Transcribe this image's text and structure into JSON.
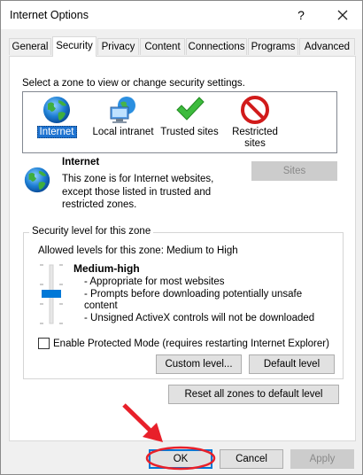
{
  "window": {
    "title": "Internet Options"
  },
  "titlebar": {
    "help_label": "?"
  },
  "tabs": [
    {
      "label": "General"
    },
    {
      "label": "Security"
    },
    {
      "label": "Privacy"
    },
    {
      "label": "Content"
    },
    {
      "label": "Connections"
    },
    {
      "label": "Programs"
    },
    {
      "label": "Advanced"
    }
  ],
  "security": {
    "instruction": "Select a zone to view or change security settings.",
    "zones": [
      {
        "label": "Internet",
        "icon": "globe-icon",
        "selected": true
      },
      {
        "label": "Local intranet",
        "icon": "network-computer-icon"
      },
      {
        "label": "Trusted sites",
        "icon": "checkmark-icon"
      },
      {
        "label": "Restricted sites",
        "label_lines": [
          "Restricted",
          "sites"
        ],
        "icon": "prohibited-icon"
      }
    ],
    "selected_zone": {
      "name": "Internet",
      "description_lines": [
        "This zone is for Internet websites,",
        "except those listed in trusted and",
        "restricted zones."
      ]
    },
    "sites_button": "Sites",
    "level_group": {
      "title": "Security level for this zone",
      "allowed": "Allowed levels for this zone: Medium to High",
      "level_name": "Medium-high",
      "bullets": [
        "- Appropriate for most websites",
        "- Prompts before downloading potentially unsafe",
        "content",
        "- Unsigned ActiveX controls will not be downloaded"
      ],
      "protected_mode_label": "Enable Protected Mode (requires restarting Internet Explorer)",
      "protected_mode_checked": false,
      "custom_level_button": "Custom level...",
      "default_level_button": "Default level"
    },
    "reset_all_button": "Reset all zones to default level"
  },
  "footer": {
    "ok": "OK",
    "cancel": "Cancel",
    "apply": "Apply"
  },
  "annotation": {
    "color": "#e8202a"
  }
}
